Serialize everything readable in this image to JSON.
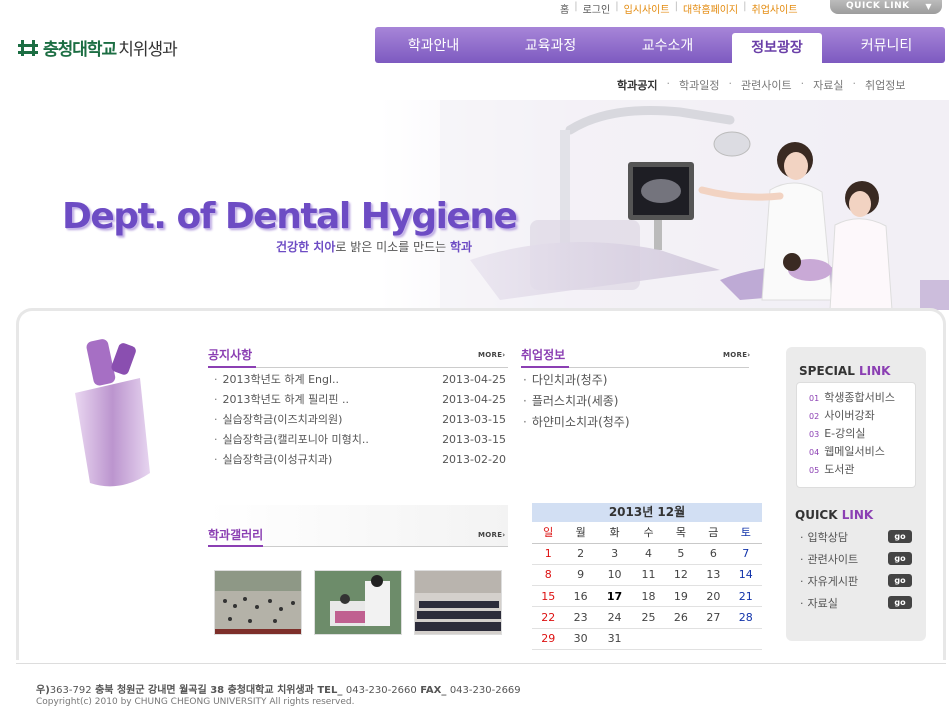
{
  "top_links": {
    "home": "홈",
    "login": "로그인",
    "admission": "입시사이트",
    "university": "대학홈페이지",
    "employment": "취업사이트",
    "quick_link": "QUICK LINK"
  },
  "logo": {
    "university": "충청대학교",
    "dept": "치위생과"
  },
  "main_nav": [
    "학과안내",
    "교육과정",
    "교수소개",
    "정보광장",
    "커뮤니티"
  ],
  "sub_nav": [
    "학과공지",
    "학과일정",
    "관련사이트",
    "자료실",
    "취업정보"
  ],
  "hero": {
    "title": "Dept. of Dental Hygiene",
    "subtitle_bold": "건강한 치아",
    "subtitle_rest": "로 밝은 미소를 만드는 ",
    "subtitle_end": "학과"
  },
  "notice": {
    "title": "공지사항",
    "more": "MORE",
    "items": [
      {
        "title": "2013학년도 하계 Engl..",
        "date": "2013-04-25"
      },
      {
        "title": "2013학년도 하계 필리핀 ..",
        "date": "2013-04-25"
      },
      {
        "title": "실습장학금(이즈치과의원)",
        "date": "2013-03-15"
      },
      {
        "title": "실습장학금(캘리포니아 미형치..",
        "date": "2013-03-15"
      },
      {
        "title": "실습장학금(이성규치과)",
        "date": "2013-02-20"
      }
    ]
  },
  "jobs": {
    "title": "취업정보",
    "more": "MORE",
    "items": [
      "다인치과(청주)",
      "플러스치과(세종)",
      "하얀미소치과(청주)"
    ]
  },
  "gallery": {
    "title": "학과갤러리",
    "more": "MORE"
  },
  "calendar": {
    "header": "2013년 12월",
    "weekdays": [
      "일",
      "월",
      "화",
      "수",
      "목",
      "금",
      "토"
    ],
    "weeks": [
      [
        "1",
        "2",
        "3",
        "4",
        "5",
        "6",
        "7"
      ],
      [
        "8",
        "9",
        "10",
        "11",
        "12",
        "13",
        "14"
      ],
      [
        "15",
        "16",
        "17",
        "18",
        "19",
        "20",
        "21"
      ],
      [
        "22",
        "23",
        "24",
        "25",
        "26",
        "27",
        "28"
      ],
      [
        "29",
        "30",
        "31",
        "",
        "",
        "",
        ""
      ]
    ],
    "today": "17"
  },
  "special_link": {
    "title_a": "SPECIAL",
    "title_b": "LINK",
    "items": [
      {
        "num": "01",
        "label": "학생종합서비스"
      },
      {
        "num": "02",
        "label": "사이버강좌"
      },
      {
        "num": "03",
        "label": "E-강의실"
      },
      {
        "num": "04",
        "label": "웹메일서비스"
      },
      {
        "num": "05",
        "label": "도서관"
      }
    ]
  },
  "quick_link": {
    "title_a": "QUICK",
    "title_b": "LINK",
    "go": "go",
    "items": [
      "입학상담",
      "관련사이트",
      "자유게시판",
      "자료실"
    ]
  },
  "footer": {
    "address_prefix": "우)",
    "zip": "363-792",
    "address": "충북 청원군 강내면 월곡길 38 충청대학교 치위생과 TEL_",
    "tel": "043-230-2660",
    "fax_label": "FAX_",
    "fax": "043-230-2669",
    "copyright": "Copyright(c) 2010 by CHUNG CHEONG UNIVERSITY All rights reserved."
  }
}
